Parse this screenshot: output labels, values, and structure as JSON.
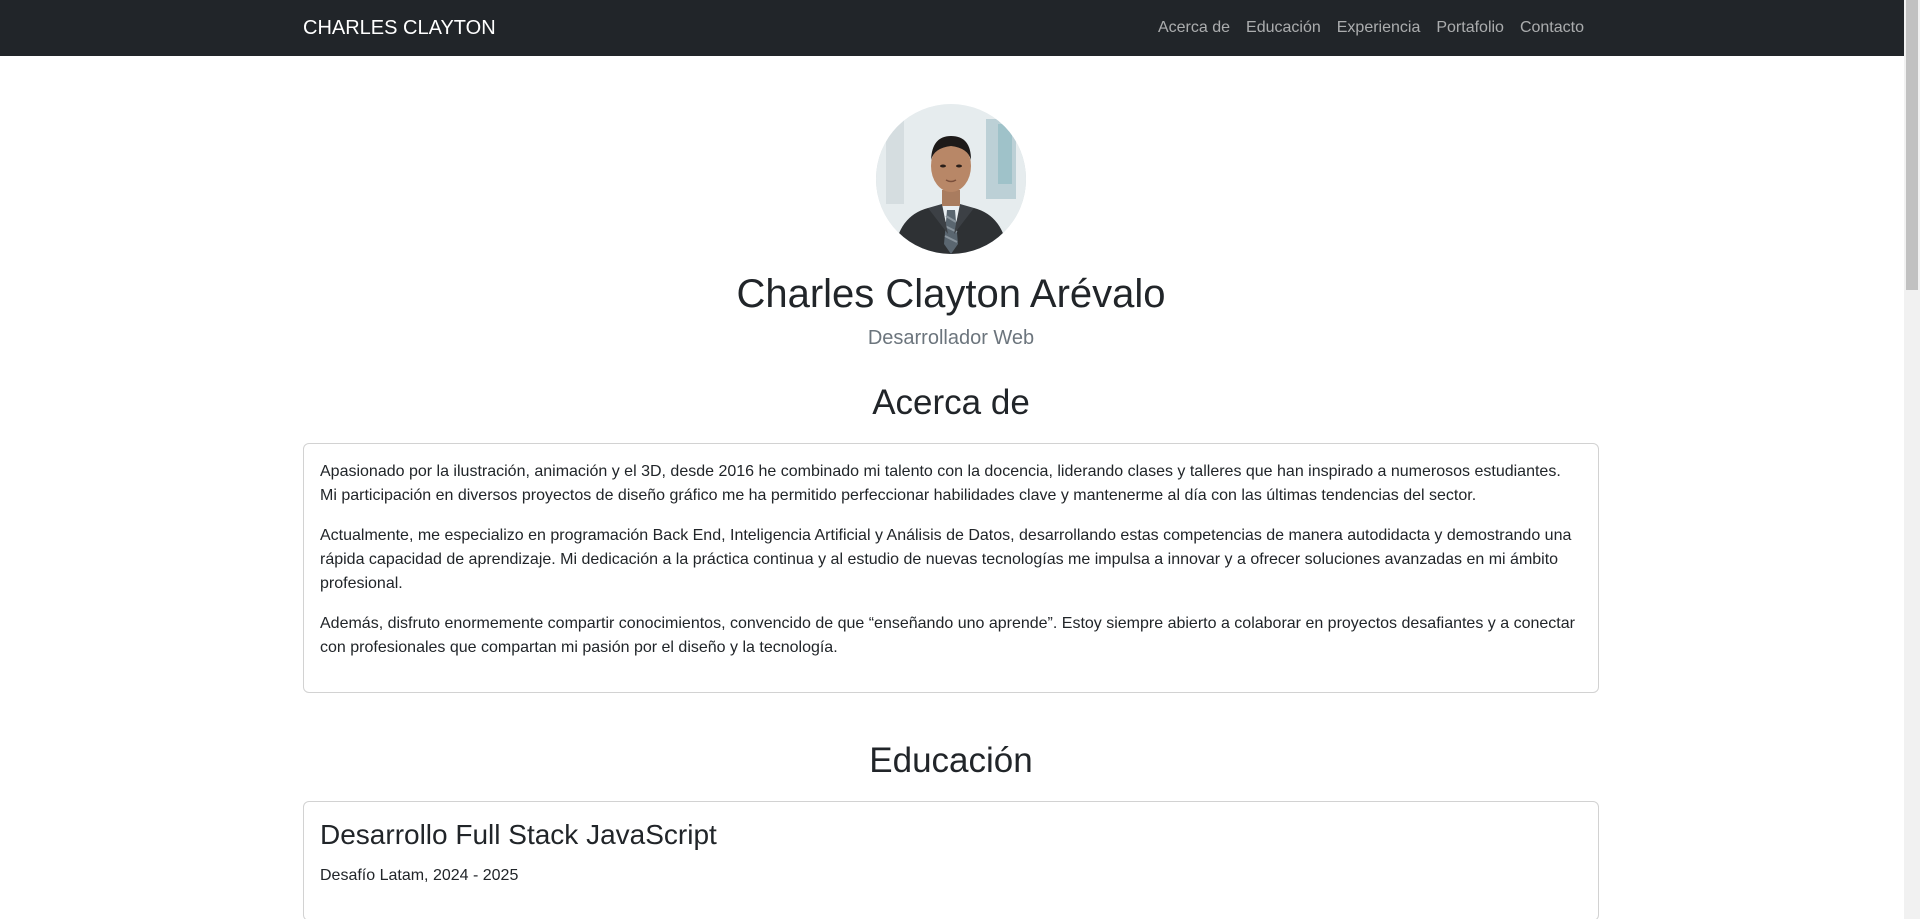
{
  "navbar": {
    "brand": "CHARLES CLAYTON",
    "links": [
      "Acerca de",
      "Educación",
      "Experiencia",
      "Portafolio",
      "Contacto"
    ]
  },
  "hero": {
    "name": "Charles Clayton Arévalo",
    "role": "Desarrollador Web"
  },
  "about": {
    "title": "Acerca de",
    "paragraphs": [
      "Apasionado por la ilustración, animación y el 3D, desde 2016 he combinado mi talento con la docencia, liderando clases y talleres que han inspirado a numerosos estudiantes. Mi participación en diversos proyectos de diseño gráfico me ha permitido perfeccionar habilidades clave y mantenerme al día con las últimas tendencias del sector.",
      "Actualmente, me especializo en programación Back End, Inteligencia Artificial y Análisis de Datos, desarrollando estas competencias de manera autodidacta y demostrando una rápida capacidad de aprendizaje. Mi dedicación a la práctica continua y al estudio de nuevas tecnologías me impulsa a innovar y a ofrecer soluciones avanzadas en mi ámbito profesional.",
      "Además, disfruto enormemente compartir conocimientos, convencido de que “enseñando uno aprende”. Estoy siempre abierto a colaborar en proyectos desafiantes y a conectar con profesionales que compartan mi pasión por el diseño y la tecnología."
    ]
  },
  "education": {
    "title": "Educación",
    "items": [
      {
        "name": "Desarrollo Full Stack JavaScript",
        "meta": "Desafío Latam, 2024 - 2025"
      }
    ]
  },
  "colors": {
    "navbar_bg": "#212529",
    "text": "#212529",
    "muted": "#6c757d"
  }
}
